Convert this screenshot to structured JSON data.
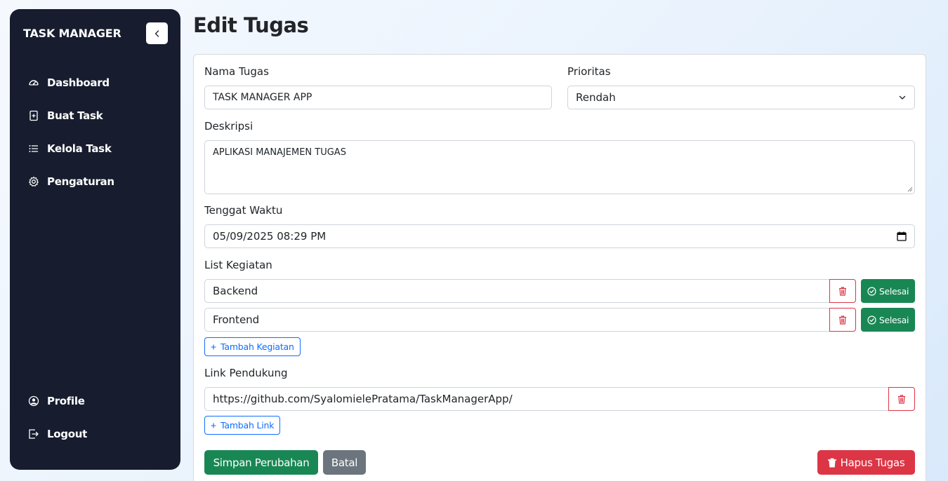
{
  "sidebar": {
    "brand": "TASK MANAGER",
    "items": [
      {
        "label": "Dashboard",
        "icon": "gauge-icon"
      },
      {
        "label": "Buat Task",
        "icon": "plus-square-icon"
      },
      {
        "label": "Kelola Task",
        "icon": "list-icon"
      },
      {
        "label": "Pengaturan",
        "icon": "gear-icon"
      }
    ],
    "bottom_items": [
      {
        "label": "Profile",
        "icon": "user-circle-icon"
      },
      {
        "label": "Logout",
        "icon": "logout-icon"
      }
    ]
  },
  "page": {
    "title": "Edit Tugas"
  },
  "form": {
    "name_label": "Nama Tugas",
    "name_value": "TASK MANAGER APP",
    "priority_label": "Prioritas",
    "priority_value": "Rendah",
    "description_label": "Deskripsi",
    "description_value": "APLIKASI MANAJEMEN TUGAS",
    "deadline_label": "Tenggat Waktu",
    "deadline_value": "05/09/2025 08:29 PM",
    "activities_label": "List Kegiatan",
    "activities": [
      {
        "value": "Backend",
        "done_label": "Selesai"
      },
      {
        "value": "Frontend",
        "done_label": "Selesai"
      }
    ],
    "add_activity_label": "Tambah Kegiatan",
    "links_label": "Link Pendukung",
    "links": [
      {
        "value": "https://github.com/SyalomielePratama/TaskManagerApp/"
      }
    ],
    "add_link_label": "Tambah Link",
    "save_label": "Simpan Perubahan",
    "cancel_label": "Batal",
    "delete_label": "Hapus Tugas"
  },
  "colors": {
    "sidebar_bg": "#171d2e",
    "success": "#198754",
    "danger": "#dc3545",
    "primary": "#0d6efd",
    "secondary": "#6c757d"
  }
}
